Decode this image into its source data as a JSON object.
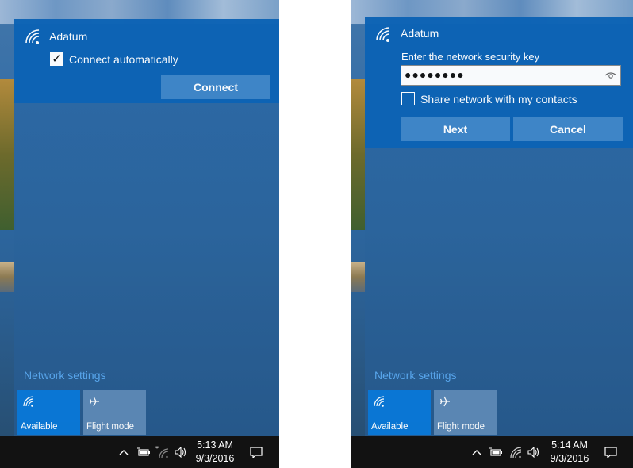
{
  "left_panel": {
    "network_name": "Adatum",
    "connect_automatically_label": "Connect automatically",
    "connect_automatically_checked": true,
    "connect_button": "Connect",
    "network_settings_link": "Network settings",
    "tiles": [
      {
        "label": "Available",
        "icon": "wifi-icon",
        "active": true
      },
      {
        "label": "Flight mode",
        "icon": "airplane-icon",
        "active": false
      }
    ],
    "taskbar": {
      "time": "5:13 AM",
      "date": "9/3/2016"
    }
  },
  "right_panel": {
    "network_name": "Adatum",
    "security_key_label": "Enter the network security key",
    "security_key_value": "●●●●●●●●",
    "share_label": "Share network with my contacts",
    "share_checked": false,
    "next_button": "Next",
    "cancel_button": "Cancel",
    "network_settings_link": "Network settings",
    "tiles": [
      {
        "label": "Available",
        "icon": "wifi-icon",
        "active": true
      },
      {
        "label": "Flight mode",
        "icon": "airplane-icon",
        "active": false
      }
    ],
    "taskbar": {
      "time": "5:14 AM",
      "date": "9/3/2016"
    }
  },
  "colors": {
    "accent": "#0c63b5",
    "tile_active": "#0a78d7",
    "link": "#5aa8ef",
    "taskbar": "#121212"
  }
}
